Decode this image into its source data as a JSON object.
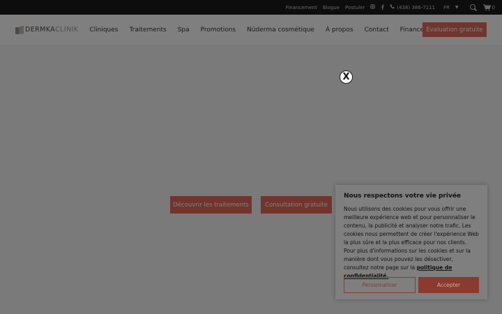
{
  "topbar": {
    "links": [
      "Financement",
      "Blogue",
      "Postuler"
    ],
    "phone": "(438) 386-7111",
    "language": "FR",
    "cart_count": "0",
    "icons": [
      "instagram-icon",
      "facebook-icon",
      "phone-icon",
      "search-icon",
      "cart-icon"
    ]
  },
  "header": {
    "logo_part1": "DERMKA",
    "logo_part2": "CLINIK",
    "nav": [
      "Cliniques",
      "Traitements",
      "Spa",
      "Promotions",
      "Nüderma cosmétique",
      "À propos",
      "Contact",
      "Financement"
    ],
    "cta": "Évaluation gratuite"
  },
  "hero": {
    "btn_treatments": "Découvrir les traitements",
    "btn_consult": "Consultation gratuite"
  },
  "popup": {
    "close": "X"
  },
  "cookie": {
    "title": "Nous respectons votre vie privée",
    "body": "Nous utilisons des cookies pour vous offrir une meilleure expérience web et pour personnaliser le contenu, la publicité et analyser notre trafic. Les cookies nous permettent de créer l'expérience Web la plus sûre et la plus efficace pour nos clients. Pour plus d'informations sur les cookies et sur la manière dont vous pouvez les désactiver, consultez notre page sur la",
    "link": "politique de confidentialité.",
    "btn_customize": "Personnaliser",
    "btn_accept": "Accepter"
  },
  "colors": {
    "accent": "#e36b5a",
    "topbar": "#1a1a1a",
    "overlay": "rgba(0,0,0,0.5)"
  }
}
